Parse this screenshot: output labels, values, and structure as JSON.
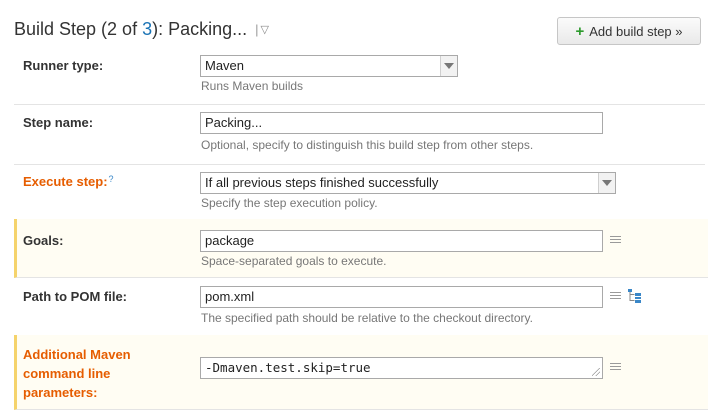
{
  "header": {
    "title_prefix": "Build Step (2 of ",
    "title_current": "3",
    "title_suffix": "): Packing...",
    "menu_bar": "|",
    "menu_arrow": "▽"
  },
  "add_button": {
    "icon": "plus-icon",
    "label": "Add build step »"
  },
  "runner": {
    "label": "Runner type:",
    "value": "Maven",
    "note": "Runs Maven builds"
  },
  "step_name": {
    "label": "Step name:",
    "value": "Packing...",
    "note": "Optional, specify to distinguish this build step from other steps."
  },
  "execute": {
    "label": "Execute step:",
    "help": "?",
    "value": "If all previous steps finished successfully",
    "note": "Specify the step execution policy."
  },
  "goals": {
    "label": "Goals:",
    "value": "package",
    "note": "Space-separated goals to execute."
  },
  "pom": {
    "label": "Path to POM file:",
    "value": "pom.xml",
    "note": "The specified path should be relative to the checkout directory."
  },
  "additional": {
    "label_line1": "Additional Maven",
    "label_line2": "command line",
    "label_line3": "parameters:",
    "value": "-Dmaven.test.skip=true"
  },
  "colors": {
    "accent_orange": "#e65d00",
    "highlight_border": "#f5d36b",
    "link_blue": "#1a73b5",
    "plus_green": "#2c9a2c"
  }
}
